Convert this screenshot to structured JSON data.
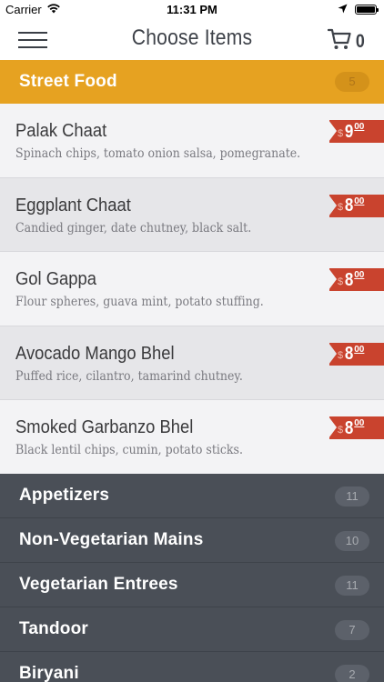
{
  "status_bar": {
    "carrier": "Carrier",
    "time": "11:31 PM"
  },
  "nav": {
    "title": "Choose Items",
    "cart_count": "0"
  },
  "active_category": {
    "name": "Street Food",
    "count": "5",
    "color": "#e6a221"
  },
  "items": [
    {
      "name": "Palak Chaat",
      "description": "Spinach chips, tomato onion salsa, pomegranate.",
      "currency": "$",
      "price_whole": "9",
      "price_cents": "00"
    },
    {
      "name": "Eggplant Chaat",
      "description": "Candied ginger, date chutney, black salt.",
      "currency": "$",
      "price_whole": "8",
      "price_cents": "00"
    },
    {
      "name": "Gol Gappa",
      "description": "Flour spheres, guava mint, potato stuffing.",
      "currency": "$",
      "price_whole": "8",
      "price_cents": "00"
    },
    {
      "name": "Avocado Mango Bhel",
      "description": "Puffed rice, cilantro, tamarind chutney.",
      "currency": "$",
      "price_whole": "8",
      "price_cents": "00"
    },
    {
      "name": "Smoked Garbanzo Bhel",
      "description": "Black lentil chips, cumin, potato sticks.",
      "currency": "$",
      "price_whole": "8",
      "price_cents": "00"
    }
  ],
  "categories": [
    {
      "name": "Appetizers",
      "count": "11"
    },
    {
      "name": "Non-Vegetarian Mains",
      "count": "10"
    },
    {
      "name": "Vegetarian Entrees",
      "count": "11"
    },
    {
      "name": "Tandoor",
      "count": "7"
    },
    {
      "name": "Biryani",
      "count": "2"
    }
  ],
  "colors": {
    "price_tag": "#c9432e",
    "category_bg": "#4a4f57"
  }
}
